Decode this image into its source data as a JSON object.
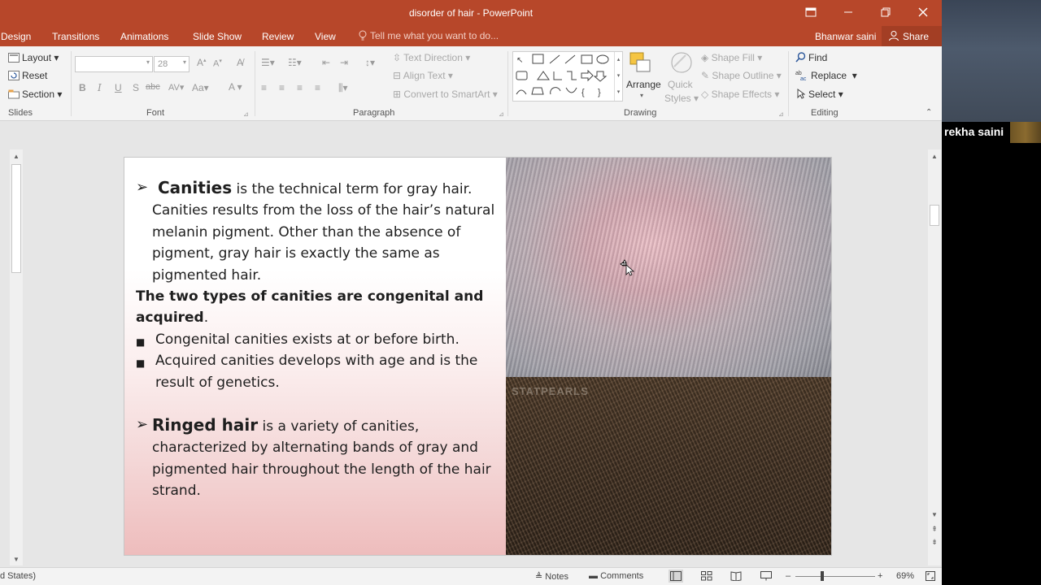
{
  "window": {
    "title": "disorder  of hair - PowerPoint"
  },
  "tabs": [
    "Design",
    "Transitions",
    "Animations",
    "Slide Show",
    "Review",
    "View"
  ],
  "tell_me": "Tell me what you want to do...",
  "user": {
    "name": "Bhanwar saini",
    "share": "Share"
  },
  "ribbon": {
    "slides": {
      "layout": "Layout",
      "reset": "Reset",
      "section": "Section",
      "label": "Slides"
    },
    "font": {
      "size": "28",
      "label": "Font"
    },
    "paragraph": {
      "text_direction": "Text Direction",
      "align_text": "Align Text",
      "convert": "Convert to SmartArt",
      "label": "Paragraph"
    },
    "drawing": {
      "arrange": "Arrange",
      "quick": "Quick",
      "styles": "Styles",
      "shape_fill": "Shape Fill",
      "shape_outline": "Shape Outline",
      "shape_effects": "Shape Effects",
      "label": "Drawing"
    },
    "editing": {
      "find": "Find",
      "replace": "Replace",
      "select": "Select",
      "label": "Editing"
    }
  },
  "slide": {
    "p1_head": "Canities",
    "p1_rest": " is the technical term for gray hair. Canities results from the loss of the hair’s natural melanin pigment. Other than the absence of pigment, gray hair is exactly the same as pigmented hair.",
    "p2_bold": " The two types of canities are congenital and acquired",
    "p2_tail": ".",
    "b1": "Congenital canities exists at or before birth.",
    "b2": " Acquired canities develops with age and is the result of genetics.",
    "p3_head": "Ringed hair",
    "p3_rest": " is a variety of canities, characterized by alternating bands of gray and pigmented hair throughout the length of the hair strand.",
    "watermark": "STATPEARLS"
  },
  "status": {
    "left": "d States)",
    "notes": "Notes",
    "comments": "Comments",
    "zoom": "69%"
  },
  "video": {
    "name": "rekha saini"
  },
  "colors": {
    "accent": "#b7472a",
    "ribbon_bg": "#f3f3f3"
  }
}
